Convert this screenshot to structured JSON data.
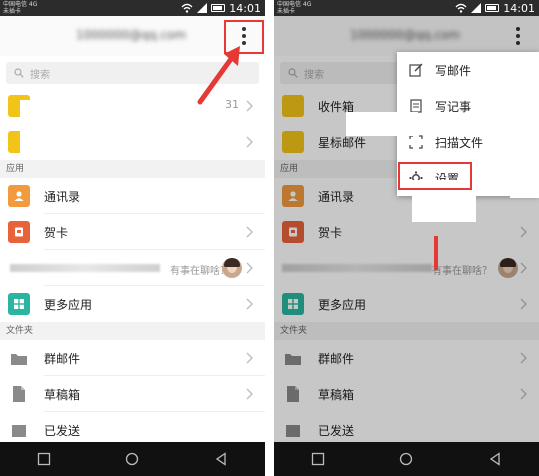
{
  "status": {
    "carrier": "中国电信 4G",
    "carrier_sub": "未插卡",
    "time": "14:01"
  },
  "search": {
    "placeholder": "搜索"
  },
  "mailboxes": [
    {
      "label": "收件箱",
      "count": "31",
      "icon": "inbox-icon",
      "color": "#f2c318"
    },
    {
      "label": "星标邮件",
      "icon": "folder-icon",
      "color": "#f2c318"
    }
  ],
  "sections": {
    "apps": "应用",
    "folders": "文件夹"
  },
  "apps": [
    {
      "label": "通讯录",
      "icon": "contacts-icon",
      "color": "#f19a3e"
    },
    {
      "label": "贺卡",
      "icon": "card-icon",
      "color": "#e8623b"
    }
  ],
  "chat": {
    "hint": "有事在聊啥？"
  },
  "more_apps": {
    "label": "更多应用",
    "icon": "grid-icon",
    "color": "#2bb5a0"
  },
  "folders": [
    {
      "label": "群邮件",
      "icon": "group-mail-icon"
    },
    {
      "label": "草稿箱",
      "icon": "draft-icon"
    },
    {
      "label": "已发送",
      "icon": "sent-icon"
    }
  ],
  "menu": {
    "items": [
      {
        "label": "写邮件",
        "icon": "compose-icon"
      },
      {
        "label": "写记事",
        "icon": "note-icon"
      },
      {
        "label": "扫描文件",
        "icon": "scan-icon"
      },
      {
        "label": "设置",
        "icon": "gear-icon"
      }
    ]
  },
  "colors": {
    "accent_red": "#e53935",
    "folder_gray": "#8a8a8a"
  }
}
